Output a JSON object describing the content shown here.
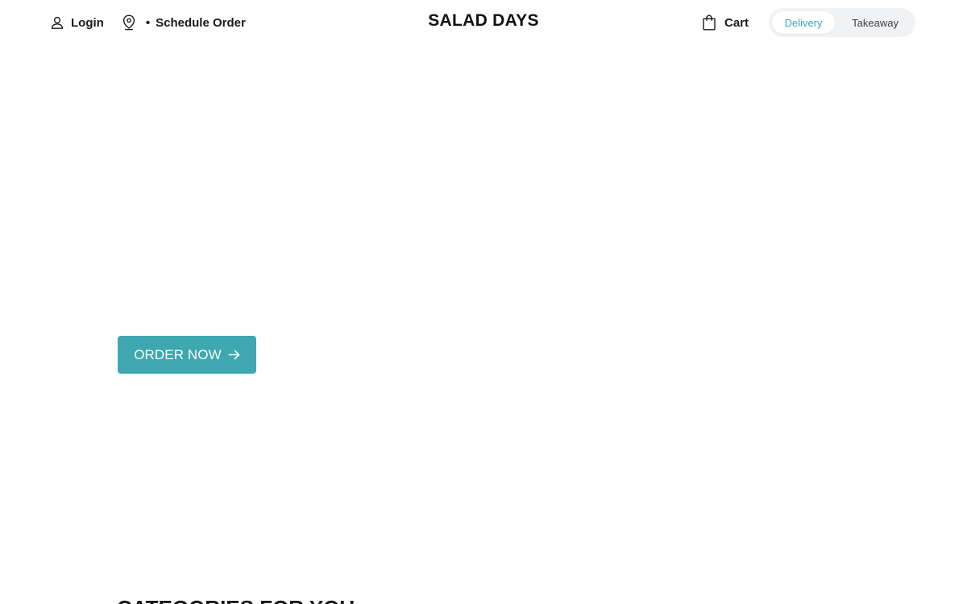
{
  "header": {
    "login_label": "Login",
    "location_separator": "•",
    "schedule_label": "Schedule Order",
    "brand_name": "SALAD DAYS",
    "cart_label": "Cart",
    "mode_toggle": {
      "active": "Delivery",
      "inactive": "Takeaway"
    }
  },
  "hero": {
    "cta_label": "ORDER NOW"
  },
  "sections": {
    "categories_title": "CATEGORIES FOR YOU"
  },
  "icons": {
    "login": "user-icon",
    "location": "map-pin-icon",
    "cart": "shopping-bag-icon",
    "cta": "arrow-right-icon"
  },
  "colors": {
    "accent": "#3ea7b0",
    "toggle_bg": "#f1f2f3",
    "text": "#1a1a1a"
  }
}
